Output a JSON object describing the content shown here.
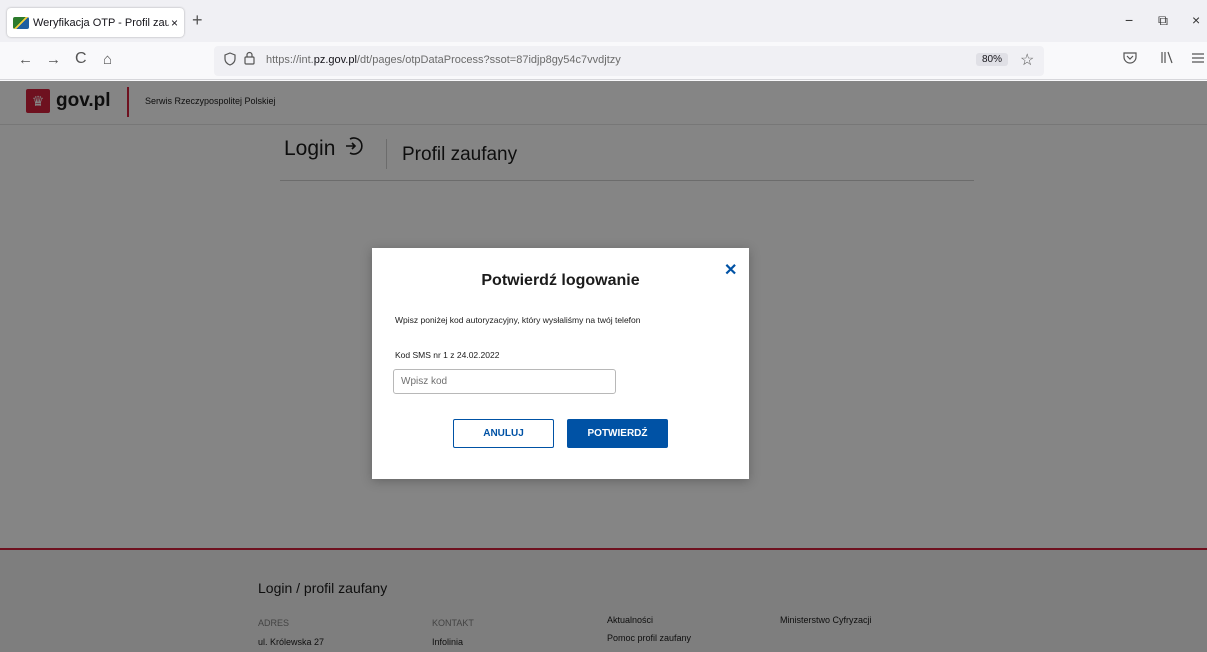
{
  "browser": {
    "tab_title": "Weryfikacja OTP - Profil zaufany",
    "tab_close": "×",
    "new_tab": "+",
    "back": "←",
    "forward": "→",
    "reload": "C",
    "home": "⌂",
    "url_prefix": "https://int.",
    "url_domain": "pz.gov.pl",
    "url_path": "/dt/pages/otpDataProcess?ssot=87idjp8gy54c7vvdjtzy",
    "zoom": "80%",
    "minimize": "−",
    "restore": "⧉",
    "close": "×"
  },
  "govbar": {
    "logo_text": "gov.pl",
    "subtitle": "Serwis Rzeczypospolitej Polskiej"
  },
  "header": {
    "login": "Login",
    "profil": "Profil zaufany"
  },
  "modal": {
    "close": "✕",
    "title": "Potwierdź logowanie",
    "description": "Wpisz poniżej kod autoryzacyjny, który wysłaliśmy na twój telefon",
    "code_label": "Kod SMS nr 1 z 24.02.2022",
    "code_placeholder": "Wpisz kod",
    "code_value": "",
    "cancel": "ANULUJ",
    "confirm": "POTWIERDŹ"
  },
  "footer": {
    "title": "Login / profil zaufany",
    "address_label": "ADRES",
    "address_value": "ul. Królewska 27",
    "contact_label": "KONTAKT",
    "contact_value": "Infolinia",
    "link1": "Aktualności",
    "link2": "Pomoc profil zaufany",
    "link3": "Ministerstwo Cyfryzacji"
  },
  "colors": {
    "accent": "#0052a5",
    "gov_red": "#d4213d"
  }
}
